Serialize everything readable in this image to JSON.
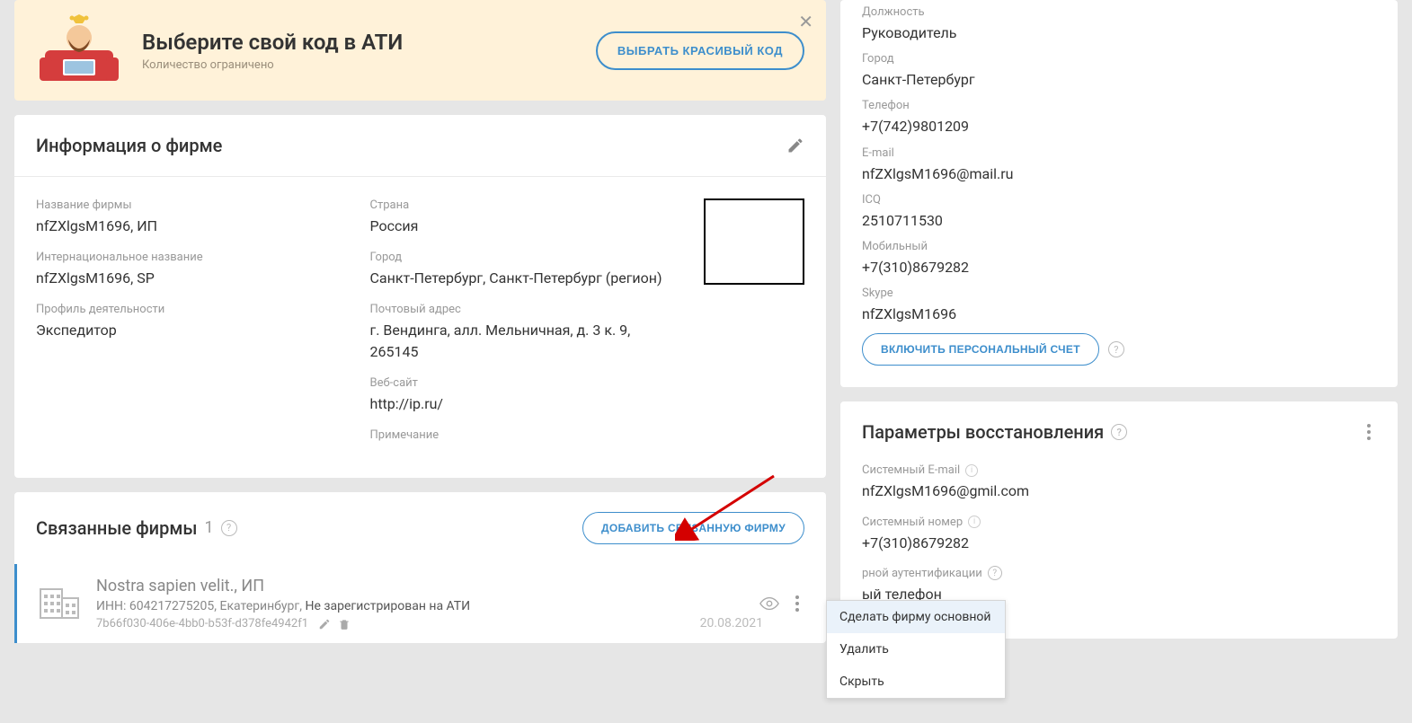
{
  "banner": {
    "title": "Выберите свой код в АТИ",
    "subtitle": "Количество ограничено",
    "button": "ВЫБРАТЬ КРАСИВЫЙ КОД"
  },
  "firm_info": {
    "header": "Информация о фирме",
    "fields": {
      "name_label": "Название фирмы",
      "name_value": "nfZXlgsM1696, ИП",
      "intl_label": "Интернациональное название",
      "intl_value": "nfZXlgsM1696, SP",
      "profile_label": "Профиль деятельности",
      "profile_value": "Экспедитор",
      "country_label": "Страна",
      "country_value": "Россия",
      "city_label": "Город",
      "city_value": "Санкт-Петербург, Санкт-Петербург (регион)",
      "postal_label": "Почтовый адрес",
      "postal_value": "г. Вендинга, алл. Мельничная, д. 3 к. 9, 265145",
      "website_label": "Веб-сайт",
      "website_value": "http://ip.ru/",
      "note_label": "Примечание"
    }
  },
  "linked": {
    "header": "Связанные фирмы",
    "count": "1",
    "add_button": "ДОБАВИТЬ СВЯЗАННУЮ ФИРМУ",
    "firm": {
      "name": "Nostra sapien velit., ИП",
      "inn_label": "ИНН:",
      "inn": "604217275205,",
      "city": "Екатеринбург,",
      "status": "Не зарегистрирован на АТИ",
      "guid": "7b66f030-406e-4bb0-b53f-d378fe4942f1",
      "date": "20.08.2021"
    },
    "menu": {
      "make_primary": "Сделать фирму основной",
      "delete": "Удалить",
      "hide": "Скрыть"
    }
  },
  "contact": {
    "position_label": "Должность",
    "position_value": "Руководитель",
    "city_label": "Город",
    "city_value": "Санкт-Петербург",
    "phone_label": "Телефон",
    "phone_value": "+7(742)9801209",
    "email_label": "E-mail",
    "email_value": "nfZXlgsM1696@mail.ru",
    "icq_label": "ICQ",
    "icq_value": "2510711530",
    "mobile_label": "Мобильный",
    "mobile_value": "+7(310)8679282",
    "skype_label": "Skype",
    "skype_value": "nfZXlgsM1696",
    "personal_account_btn": "ВКЛЮЧИТЬ ПЕРСОНАЛЬНЫЙ СЧЕТ"
  },
  "recovery": {
    "header": "Параметры восстановления",
    "sys_email_label": "Системный E-mail",
    "sys_email_value": "nfZXlgsM1696@gmil.com",
    "sys_number_label": "Системный номер",
    "sys_number_value": "+7(310)8679282",
    "twofa_label_partial": "рной аутентификации",
    "twofa_value_partial": "ый телефон"
  }
}
